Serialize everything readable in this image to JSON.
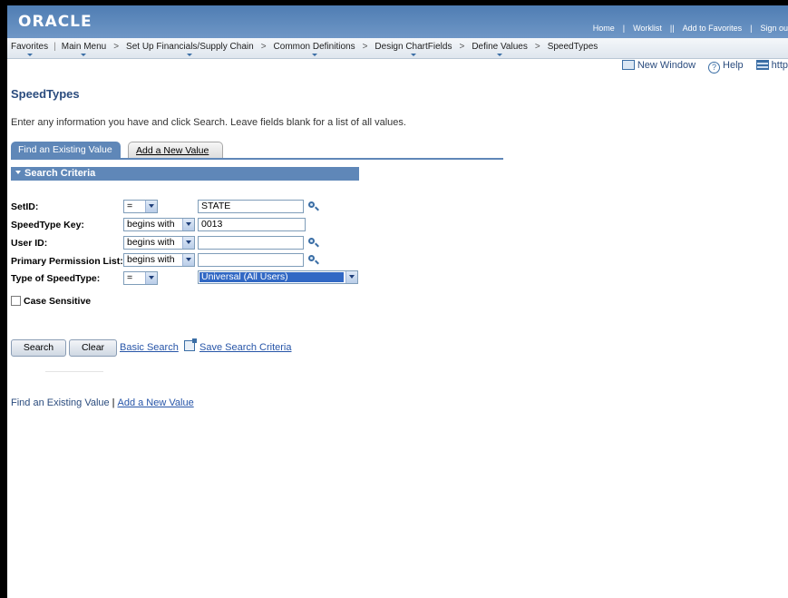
{
  "header": {
    "logo": "ORACLE",
    "links": [
      "Home",
      "Worklist",
      "Add to Favorites",
      "Sign ou"
    ]
  },
  "breadcrumbs": [
    "Favorites",
    "Main Menu",
    "Set Up Financials/Supply Chain",
    "Common Definitions",
    "Design ChartFields",
    "Define Values",
    "SpeedTypes"
  ],
  "pagebar": {
    "new_window": "New Window",
    "help": "Help",
    "http": "http"
  },
  "page": {
    "title": "SpeedTypes",
    "instructions": "Enter any information you have and click Search. Leave fields blank for a list of all values."
  },
  "tabs": {
    "find": "Find an Existing Value",
    "add": "Add a New Value"
  },
  "section": {
    "title": "Search Criteria"
  },
  "fields": [
    {
      "label": "SetID:",
      "operator": "=",
      "value": "STATE"
    },
    {
      "label": "SpeedType Key:",
      "operator": "begins with",
      "value": "0013"
    },
    {
      "label": "User ID:",
      "operator": "begins with",
      "value": ""
    },
    {
      "label": "Primary Permission List:",
      "operator": "begins with",
      "value": ""
    },
    {
      "label": "Type of SpeedType:",
      "operator": "=",
      "value": "Universal (All Users)"
    }
  ],
  "case_sensitive": {
    "label": "Case Sensitive",
    "checked": false
  },
  "actions": {
    "search": "Search",
    "clear": "Clear",
    "basic_search": "Basic Search",
    "save_search": "Save Search Criteria"
  },
  "bottom_links": {
    "find": "Find an Existing Value",
    "separator": "|",
    "add": "Add a New Value"
  },
  "colors": {
    "header": "#5f87b8",
    "link": "#2755a8",
    "selection": "#3168c4"
  }
}
